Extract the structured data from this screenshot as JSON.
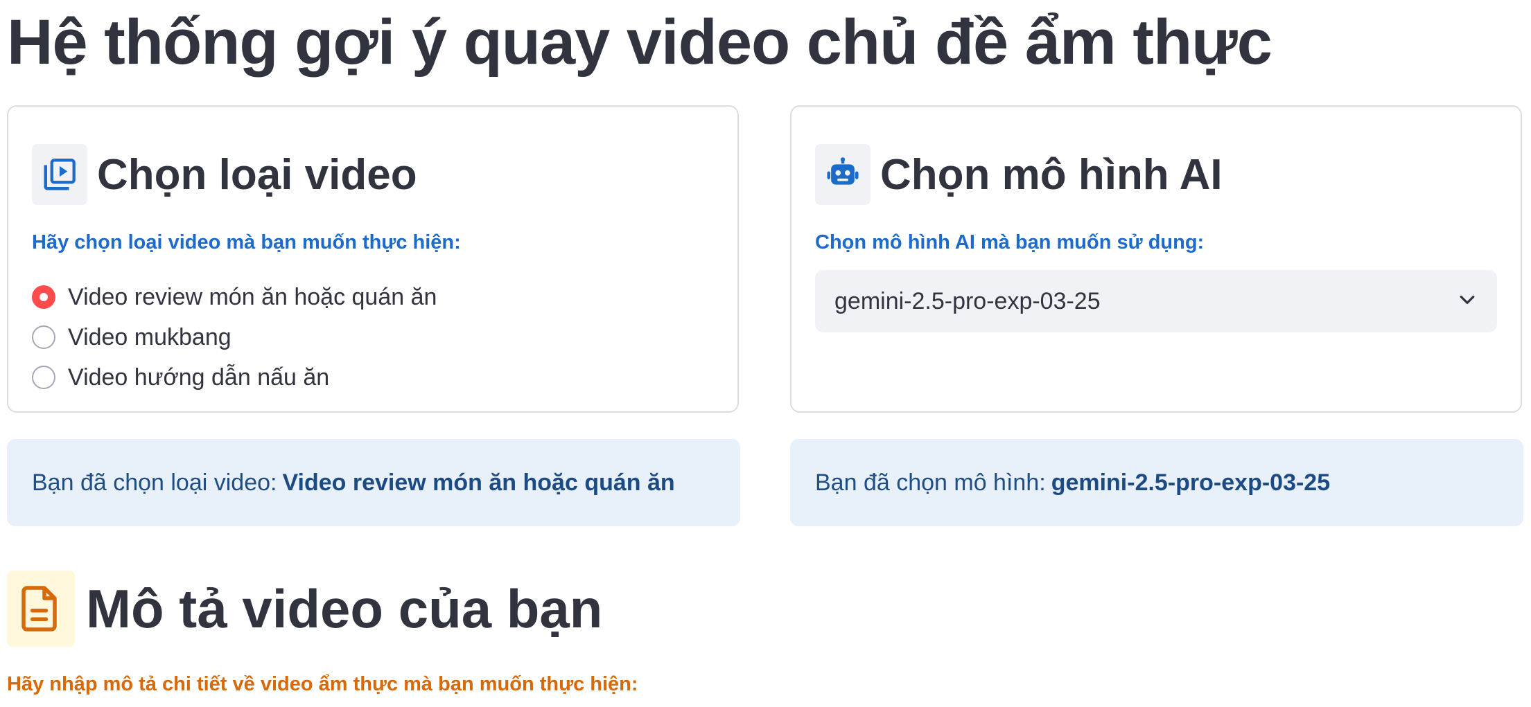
{
  "page_title": "Hệ thống gợi ý quay video chủ đề ẩm thực",
  "video_type_card": {
    "icon": "video-library-icon",
    "title": "Chọn loại video",
    "prompt": "Hãy chọn loại video mà bạn muốn thực hiện:",
    "options": [
      {
        "label": "Video review món ăn hoặc quán ăn",
        "selected": true
      },
      {
        "label": "Video mukbang",
        "selected": false
      },
      {
        "label": "Video hướng dẫn nấu ăn",
        "selected": false
      }
    ]
  },
  "model_card": {
    "icon": "robot-icon",
    "title": "Chọn mô hình AI",
    "prompt": "Chọn mô hình AI mà bạn muốn sử dụng:",
    "selected_model": "gemini-2.5-pro-exp-03-25"
  },
  "info": {
    "video_prefix": "Bạn đã chọn loại video:",
    "video_value": "Video review món ăn hoặc quán ăn",
    "model_prefix": "Bạn đã chọn mô hình:",
    "model_value": "gemini-2.5-pro-exp-03-25"
  },
  "description_section": {
    "icon": "document-icon",
    "title": "Mô tả video của bạn",
    "prompt": "Hãy nhập mô tả chi tiết về video ẩm thực mà bạn muốn thực hiện:"
  },
  "colors": {
    "accent_radio": "#ff4b4b",
    "blue_text": "#1c6ac9",
    "orange_text": "#d6690a",
    "info_bg": "#e8f0fa"
  }
}
